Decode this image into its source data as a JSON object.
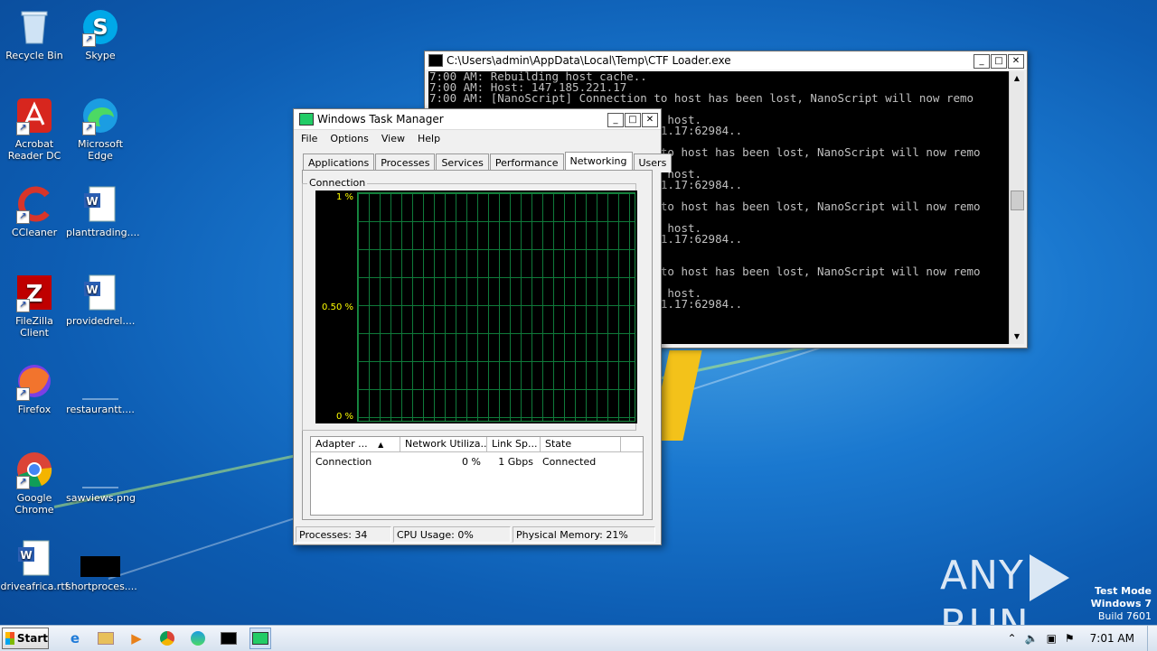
{
  "desktop": {
    "icons": [
      {
        "label": "Recycle Bin",
        "icon": "recycle-bin-icon"
      },
      {
        "label": "Skype",
        "icon": "skype-icon"
      },
      {
        "label": "Acrobat Reader DC",
        "icon": "acrobat-icon"
      },
      {
        "label": "Microsoft Edge",
        "icon": "edge-icon"
      },
      {
        "label": "CCleaner",
        "icon": "ccleaner-icon"
      },
      {
        "label": "planttrading....",
        "icon": "word-doc-icon"
      },
      {
        "label": "FileZilla Client",
        "icon": "filezilla-icon"
      },
      {
        "label": "providedrel....",
        "icon": "word-doc-icon"
      },
      {
        "label": "Firefox",
        "icon": "firefox-icon"
      },
      {
        "label": "restaurantt....",
        "icon": "blank-file-icon"
      },
      {
        "label": "Google Chrome",
        "icon": "chrome-icon"
      },
      {
        "label": "sawviews.png",
        "icon": "image-file-icon"
      },
      {
        "label": "driveafrica.rtf",
        "icon": "word-doc-icon"
      },
      {
        "label": "shortproces....",
        "icon": "black-image-icon"
      }
    ]
  },
  "console": {
    "title": "C:\\Users\\admin\\AppData\\Local\\Temp\\CTF Loader.exe",
    "lines": [
      "7:00 AM: Rebuilding host cache..",
      "7:00 AM: Host: 147.185.221.17",
      "7:00 AM: [NanoScript] Connection to host has been lost, NanoScript will now remo",
      "",
      "                                 e host.",
      "                                 21.17:62984..",
      "",
      "                                  to host has been lost, NanoScript will now remo",
      "",
      "                                 e host.",
      "                                 21.17:62984..",
      "",
      "                                  to host has been lost, NanoScript will now remo",
      "",
      "                                 e host.",
      "                                 21.17:62984..",
      "",
      "",
      "                                  to host has been lost, NanoScript will now remo",
      "",
      "                                 e host.",
      "                                 21.17:62984.."
    ]
  },
  "taskmanager": {
    "title": "Windows Task Manager",
    "menu": [
      "File",
      "Options",
      "View",
      "Help"
    ],
    "tabs": [
      "Applications",
      "Processes",
      "Services",
      "Performance",
      "Networking",
      "Users"
    ],
    "active_tab": "Networking",
    "group_label": "Connection",
    "axis": {
      "top": "1 %",
      "mid": "0.50 %",
      "bottom": "0 %"
    },
    "columns": [
      "Adapter ...",
      "Network Utiliza...",
      "Link Sp...",
      "State"
    ],
    "rows": [
      {
        "adapter": "Connection",
        "util": "0 %",
        "speed": "1 Gbps",
        "state": "Connected"
      }
    ],
    "status": {
      "processes": "Processes: 34",
      "cpu": "CPU Usage: 0%",
      "memory": "Physical Memory: 21%"
    }
  },
  "watermark": {
    "left": "ANY",
    "right": "RUN"
  },
  "testmode": {
    "line1": "Test Mode",
    "line2": "Windows 7",
    "line3": "Build 7601"
  },
  "taskbar": {
    "start": "Start",
    "clock": "7:01 AM"
  }
}
